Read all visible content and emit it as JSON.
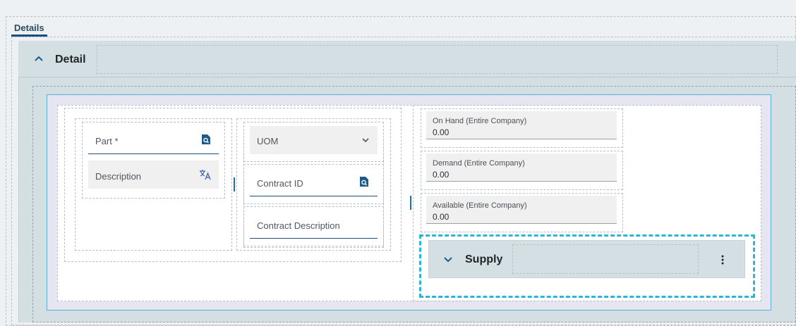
{
  "tabs": [
    {
      "label": "Details",
      "active": true
    }
  ],
  "detail": {
    "title": "Detail",
    "expanded": true,
    "toggle_icon": "chevron-up-icon"
  },
  "fields": {
    "part": {
      "label": "Part *",
      "icon": "search-record-icon"
    },
    "description": {
      "label": "Description",
      "icon": "translate-icon"
    },
    "uom": {
      "label": "UOM",
      "icon": "chevron-down-icon"
    },
    "contract_id": {
      "label": "Contract ID",
      "icon": "search-record-icon"
    },
    "contract_description": {
      "label": "Contract Description"
    }
  },
  "quantities": [
    {
      "label": "On Hand (Entire Company)",
      "value": "0.00"
    },
    {
      "label": "Demand (Entire Company)",
      "value": "0.00"
    },
    {
      "label": "Available (Entire Company)",
      "value": "0.00"
    }
  ],
  "supply": {
    "title": "Supply",
    "expanded": false,
    "toggle_icon": "chevron-down-icon",
    "menu_icon": "more-vertical-icon"
  },
  "colors": {
    "accent": "#1d4f78",
    "focus": "#2bb6d8",
    "panel": "#d3dfe2",
    "card_border": "#5cb0d8"
  }
}
